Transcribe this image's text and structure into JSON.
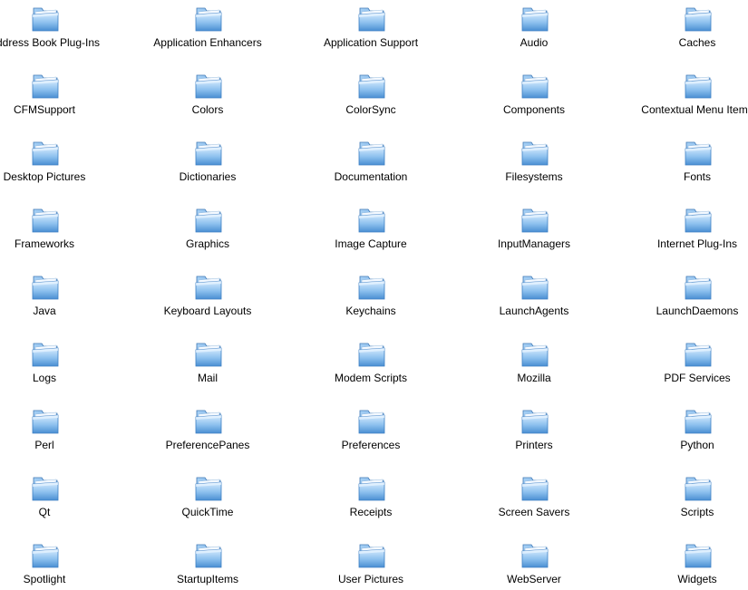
{
  "window": {
    "view": "icon-view"
  },
  "icons": {
    "folder": "folder-icon"
  },
  "colors": {
    "background": "#ffffff",
    "label_text": "#000000",
    "folder_light": "#cfe8ff",
    "folder_mid": "#7fb8ec",
    "folder_dark": "#3d7fc4"
  },
  "folders": [
    [
      "Address Book Plug-Ins",
      "Application Enhancers",
      "Application Support",
      "Audio",
      "Caches"
    ],
    [
      "CFMSupport",
      "Colors",
      "ColorSync",
      "Components",
      "Contextual Menu Items"
    ],
    [
      "Desktop Pictures",
      "Dictionaries",
      "Documentation",
      "Filesystems",
      "Fonts"
    ],
    [
      "Frameworks",
      "Graphics",
      "Image Capture",
      "InputManagers",
      "Internet Plug-Ins"
    ],
    [
      "Java",
      "Keyboard Layouts",
      "Keychains",
      "LaunchAgents",
      "LaunchDaemons"
    ],
    [
      "Logs",
      "Mail",
      "Modem Scripts",
      "Mozilla",
      "PDF Services"
    ],
    [
      "Perl",
      "PreferencePanes",
      "Preferences",
      "Printers",
      "Python"
    ],
    [
      "Qt",
      "QuickTime",
      "Receipts",
      "Screen Savers",
      "Scripts"
    ],
    [
      "Spotlight",
      "StartupItems",
      "User Pictures",
      "WebServer",
      "Widgets"
    ]
  ]
}
